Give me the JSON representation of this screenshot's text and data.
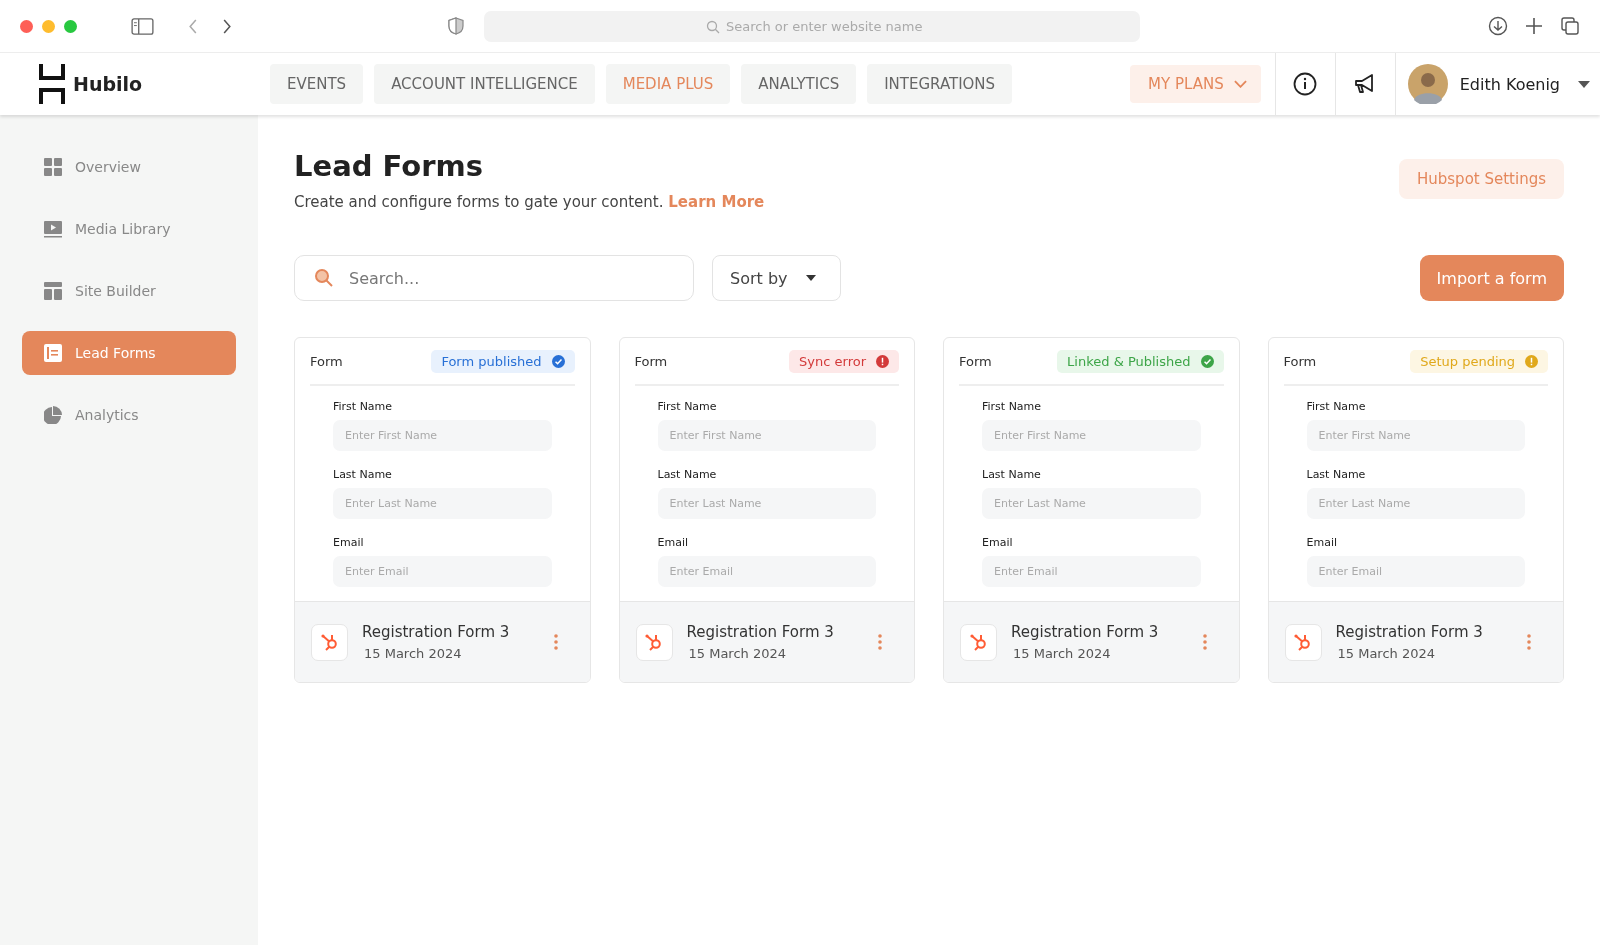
{
  "browser": {
    "address_placeholder": "Search or enter website name"
  },
  "brand": {
    "name": "Hubilo"
  },
  "nav_tabs": [
    {
      "label": "EVENTS",
      "selected": false
    },
    {
      "label": "ACCOUNT INTELLIGENCE",
      "selected": false
    },
    {
      "label": "MEDIA PLUS",
      "selected": true
    },
    {
      "label": "ANALYTICS",
      "selected": false
    },
    {
      "label": "INTEGRATIONS",
      "selected": false
    }
  ],
  "plans_button": {
    "label": "MY PLANS"
  },
  "user": {
    "name": "Edith Koenig"
  },
  "sidebar": {
    "items": [
      {
        "label": "Overview",
        "kind": "grid",
        "selected": false
      },
      {
        "label": "Media Library",
        "kind": "media",
        "selected": false
      },
      {
        "label": "Site Builder",
        "kind": "layout",
        "selected": false
      },
      {
        "label": "Lead Forms",
        "kind": "form",
        "selected": true
      },
      {
        "label": "Analytics",
        "kind": "pie",
        "selected": false
      }
    ]
  },
  "page": {
    "title": "Lead Forms",
    "subtitle": "Create and configure forms to gate your content.",
    "link": "Learn More",
    "settings_button": "Hubspot Settings"
  },
  "toolbar": {
    "search_placeholder": "Search...",
    "sort_label": "Sort by",
    "import_button": "Import a form"
  },
  "cards": [
    {
      "header": "Form",
      "status": {
        "label": "Form published",
        "kind": "published"
      },
      "fields": [
        {
          "label": "First Name",
          "placeholder": "Enter First Name"
        },
        {
          "label": "Last Name",
          "placeholder": "Enter Last Name"
        },
        {
          "label": "Email",
          "placeholder": "Enter Email"
        }
      ],
      "name": "Registration Form 3",
      "date": "15 March 2024"
    },
    {
      "header": "Form",
      "status": {
        "label": "Sync error",
        "kind": "error"
      },
      "fields": [
        {
          "label": "First Name",
          "placeholder": "Enter First Name"
        },
        {
          "label": "Last Name",
          "placeholder": "Enter Last Name"
        },
        {
          "label": "Email",
          "placeholder": "Enter Email"
        }
      ],
      "name": "Registration Form 3",
      "date": "15 March 2024"
    },
    {
      "header": "Form",
      "status": {
        "label": "Linked & Published",
        "kind": "linked"
      },
      "fields": [
        {
          "label": "First Name",
          "placeholder": "Enter First Name"
        },
        {
          "label": "Last Name",
          "placeholder": "Enter Last Name"
        },
        {
          "label": "Email",
          "placeholder": "Enter Email"
        }
      ],
      "name": "Registration Form 3",
      "date": "15 March 2024"
    },
    {
      "header": "Form",
      "status": {
        "label": "Setup pending",
        "kind": "pending"
      },
      "fields": [
        {
          "label": "First Name",
          "placeholder": "Enter First Name"
        },
        {
          "label": "Last Name",
          "placeholder": "Enter Last Name"
        },
        {
          "label": "Email",
          "placeholder": "Enter Email"
        }
      ],
      "name": "Registration Form 3",
      "date": "15 March 2024"
    }
  ]
}
